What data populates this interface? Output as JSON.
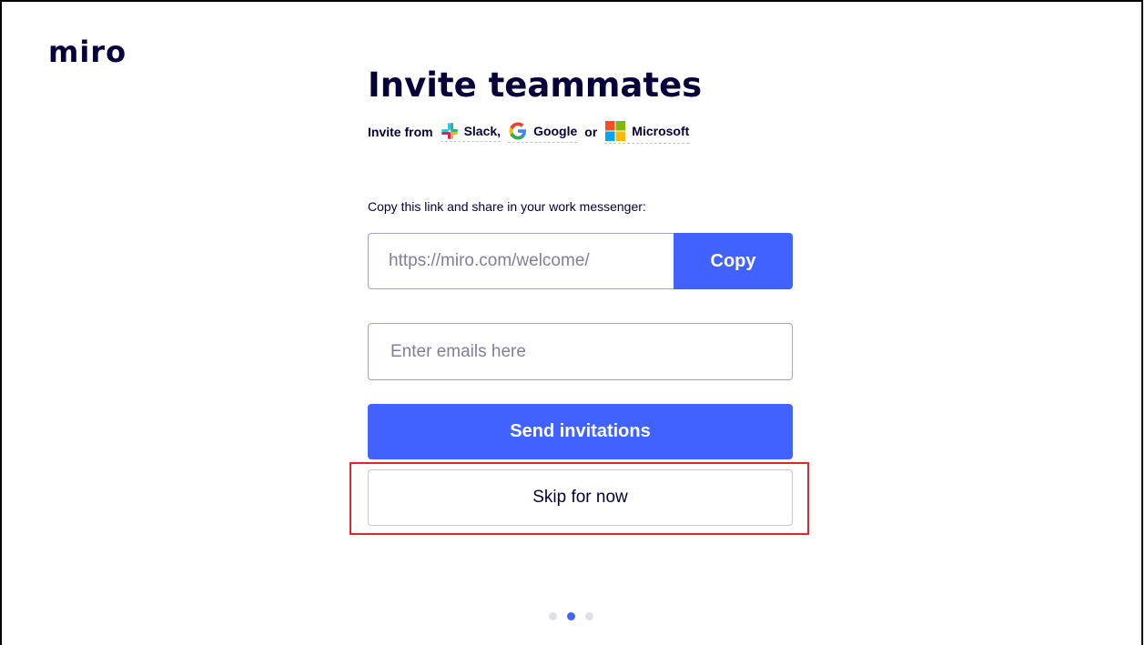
{
  "brand": {
    "logo_text": "miro",
    "accent_color": "#4262ff",
    "text_color": "#050038",
    "highlight_color": "#e0262d"
  },
  "header": {
    "title": "Invite teammates"
  },
  "invite_from": {
    "prefix": "Invite from",
    "providers": [
      {
        "label": "Slack,",
        "icon": "slack-icon"
      },
      {
        "label": "Google",
        "icon": "google-icon"
      },
      {
        "label": "Microsoft",
        "icon": "microsoft-icon"
      }
    ],
    "separator": "or"
  },
  "share_link": {
    "label": "Copy this link and share in your work messenger:",
    "value": "https://miro.com/welcome/",
    "copy_label": "Copy"
  },
  "email": {
    "placeholder": "Enter emails here",
    "value": ""
  },
  "actions": {
    "send_label": "Send invitations",
    "skip_label": "Skip for now"
  },
  "pagination": {
    "total": 3,
    "current": 2
  }
}
